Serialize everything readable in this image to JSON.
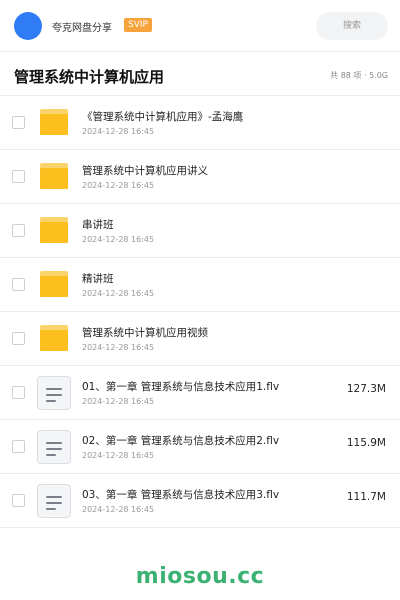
{
  "header": {
    "share_name": "夸克网盘分享",
    "badge": "SVIP",
    "search_label": "搜索"
  },
  "title_row": {
    "title": "管理系统中计算机应用",
    "summary": "共 88 项 · 5.0G"
  },
  "files": [
    {
      "type": "folder",
      "name": "《管理系统中计算机应用》-孟海鹰",
      "date": "2024-12-28 16:45",
      "size": ""
    },
    {
      "type": "folder",
      "name": "管理系统中计算机应用讲义",
      "date": "2024-12-28 16:45",
      "size": ""
    },
    {
      "type": "folder",
      "name": "串讲班",
      "date": "2024-12-28 16:45",
      "size": ""
    },
    {
      "type": "folder",
      "name": "精讲班",
      "date": "2024-12-28 16:45",
      "size": ""
    },
    {
      "type": "folder",
      "name": "管理系统中计算机应用视频",
      "date": "2024-12-28 16:45",
      "size": ""
    },
    {
      "type": "file",
      "name": "01、第一章 管理系统与信息技术应用1.flv",
      "date": "2024-12-28 16:45",
      "size": "127.3M"
    },
    {
      "type": "file",
      "name": "02、第一章 管理系统与信息技术应用2.flv",
      "date": "2024-12-28 16:45",
      "size": "115.9M"
    },
    {
      "type": "file",
      "name": "03、第一章 管理系统与信息技术应用3.flv",
      "date": "2024-12-28 16:45",
      "size": "111.7M"
    }
  ],
  "footer": {
    "brand": "miosou.cc"
  },
  "colors": {
    "avatar": "#2f7cf6",
    "svip_badge": "#f7a23a",
    "folder": "#fdbf1e",
    "brand": "#3bb273"
  }
}
